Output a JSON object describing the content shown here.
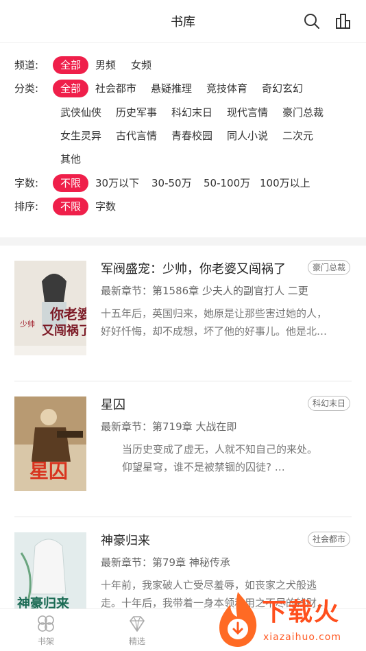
{
  "header": {
    "title": "书库",
    "icons": [
      "search-icon",
      "ranking-icon"
    ]
  },
  "filters": {
    "channel": {
      "label": "频道:",
      "options": [
        "全部",
        "男频",
        "女频"
      ],
      "selected": "全部"
    },
    "category": {
      "label": "分类:",
      "options": [
        "全部",
        "社会都市",
        "悬疑推理",
        "竞技体育",
        "奇幻玄幻",
        "武侠仙侠",
        "历史军事",
        "科幻末日",
        "现代言情",
        "豪门总裁",
        "女生灵异",
        "古代言情",
        "青春校园",
        "同人小说",
        "二次元",
        "其他"
      ],
      "selected": "全部"
    },
    "words": {
      "label": "字数:",
      "options": [
        "不限",
        "30万以下",
        "30-50万",
        "50-100万",
        "100万以上"
      ],
      "selected": "不限"
    },
    "sort": {
      "label": "排序:",
      "options": [
        "不限",
        "字数"
      ],
      "selected": "不限"
    }
  },
  "books": [
    {
      "title": "军阀盛宠：少帅，你老婆又闯祸了",
      "tag": "豪门总裁",
      "chapter": "最新章节：第1586章 少夫人的副官打人 二更",
      "desc_lines": [
        "十五年后，英国归来，她原是让那些害过她的人，",
        "好好忏悔，却不成想，坏了他的好事儿。他是北…"
      ],
      "cover_text": [
        "少帅",
        "你老婆",
        "又闯祸了"
      ],
      "cover_colors": [
        "#e9e4dc",
        "#8a1f2a"
      ]
    },
    {
      "title": "星囚",
      "tag": "科幻末日",
      "chapter": "最新章节：第719章 大战在即",
      "desc_lines": [
        "当历史变成了虚无，人就不知自己的来处。",
        "仰望星穹，谁不是被禁锢的囚徒?        …"
      ],
      "cover_text": [
        "星囚"
      ],
      "cover_colors": [
        "#6b4a2a",
        "#d8341f"
      ]
    },
    {
      "title": "神豪归来",
      "tag": "社会都市",
      "chapter": "最新章节：第79章 神秘传承",
      "desc_lines": [
        "十年前，我家破人亡受尽羞辱，如丧家之犬般逃",
        "走。十年后，我带着一身本领和用之不尽的钱财…"
      ],
      "cover_text": [
        "神豪归来"
      ],
      "cover_colors": [
        "#dfe9ea",
        "#1b6b54"
      ]
    }
  ],
  "tabbar": {
    "tabs": [
      "书架",
      "精选"
    ]
  },
  "watermark": {
    "name": "下载火",
    "url": "xiazaihuo.com"
  },
  "colors": {
    "accent": "#ef1f4a",
    "watermark": "#ff4f1d"
  }
}
